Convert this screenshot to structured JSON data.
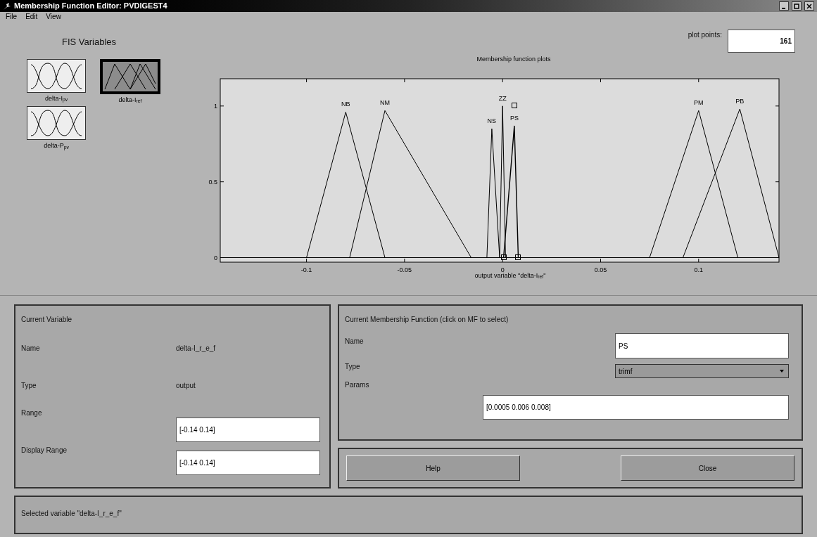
{
  "window": {
    "title": "Membership Function Editor: PVDIGEST4"
  },
  "menu": [
    "File",
    "Edit",
    "View"
  ],
  "fis_variables": {
    "title": "FIS Variables",
    "items": [
      {
        "label": "delta-I$_{pv}$",
        "selected": false,
        "kind": "gaussian"
      },
      {
        "label": "delta-I$_{ref}$",
        "selected": true,
        "kind": "triangular"
      },
      {
        "label": "delta-P$_{pv}$",
        "selected": false,
        "kind": "gaussian"
      }
    ]
  },
  "plot": {
    "plot_points_label": "plot points:",
    "plot_points": "161",
    "title": "Membership function plots",
    "xlabel": "output variable \"delta-I$_{ref}$\"",
    "chart_data": {
      "type": "line",
      "xlim": [
        -0.144,
        0.141
      ],
      "xticks": [
        {
          "value": -0.1,
          "label": "-0.1"
        },
        {
          "value": -0.05,
          "label": "-0.05"
        },
        {
          "value": 0,
          "label": "0"
        },
        {
          "value": 0.05,
          "label": "0.05"
        },
        {
          "value": 0.1,
          "label": "0.1"
        }
      ],
      "yticks": [
        0,
        0.5,
        1
      ],
      "series": [
        {
          "name": "NB",
          "color": "#000000",
          "x": [
            -0.1,
            -0.08,
            -0.06
          ],
          "values": [
            0,
            0.96,
            0
          ]
        },
        {
          "name": "NM",
          "color": "#000000",
          "x": [
            -0.078,
            -0.06,
            -0.016
          ],
          "values": [
            0,
            0.97,
            0
          ]
        },
        {
          "name": "NS",
          "color": "#000000",
          "x": [
            -0.008,
            -0.0055,
            -0.0015
          ],
          "values": [
            0,
            0.85,
            0
          ]
        },
        {
          "name": "ZZ",
          "color": "#000000",
          "x": [
            -0.0015,
            0,
            0.0015
          ],
          "values": [
            0,
            1,
            0
          ]
        },
        {
          "name": "PS",
          "color": "#000000",
          "x": [
            0.0005,
            0.006,
            0.008
          ],
          "values": [
            0,
            0.87,
            0
          ]
        },
        {
          "name": "PM",
          "color": "#000000",
          "x": [
            0.075,
            0.1,
            0.12
          ],
          "values": [
            0,
            0.97,
            0
          ]
        },
        {
          "name": "PB",
          "color": "#000000",
          "x": [
            0.092,
            0.121,
            0.141
          ],
          "values": [
            0,
            0.98,
            0
          ]
        }
      ],
      "ylim": [
        -0.03,
        1.18
      ]
    },
    "mf_states": [
      {
        "selected": false
      },
      {
        "selected": false
      },
      {
        "selected": false
      },
      {
        "selected": false
      },
      {
        "selected": true
      },
      {
        "selected": false
      },
      {
        "selected": false
      }
    ]
  },
  "current_variable": {
    "title": "Current Variable",
    "name_label": "Name",
    "name": "delta-I_r_e_f",
    "type_label": "Type",
    "type": "output",
    "range_label": "Range",
    "range": "[-0.14 0.14]",
    "display_range_label": "Display Range",
    "display_range": "[-0.14 0.14]"
  },
  "current_mf": {
    "title": "Current Membership Function (click on MF to select)",
    "name_label": "Name",
    "name": "PS",
    "type_label": "Type",
    "type": "trimf",
    "params_label": "Params",
    "params": "[0.0005 0.006 0.008]"
  },
  "buttons": [
    "Help",
    "Close"
  ],
  "status": "Selected variable \"delta-I_r_e_f\""
}
